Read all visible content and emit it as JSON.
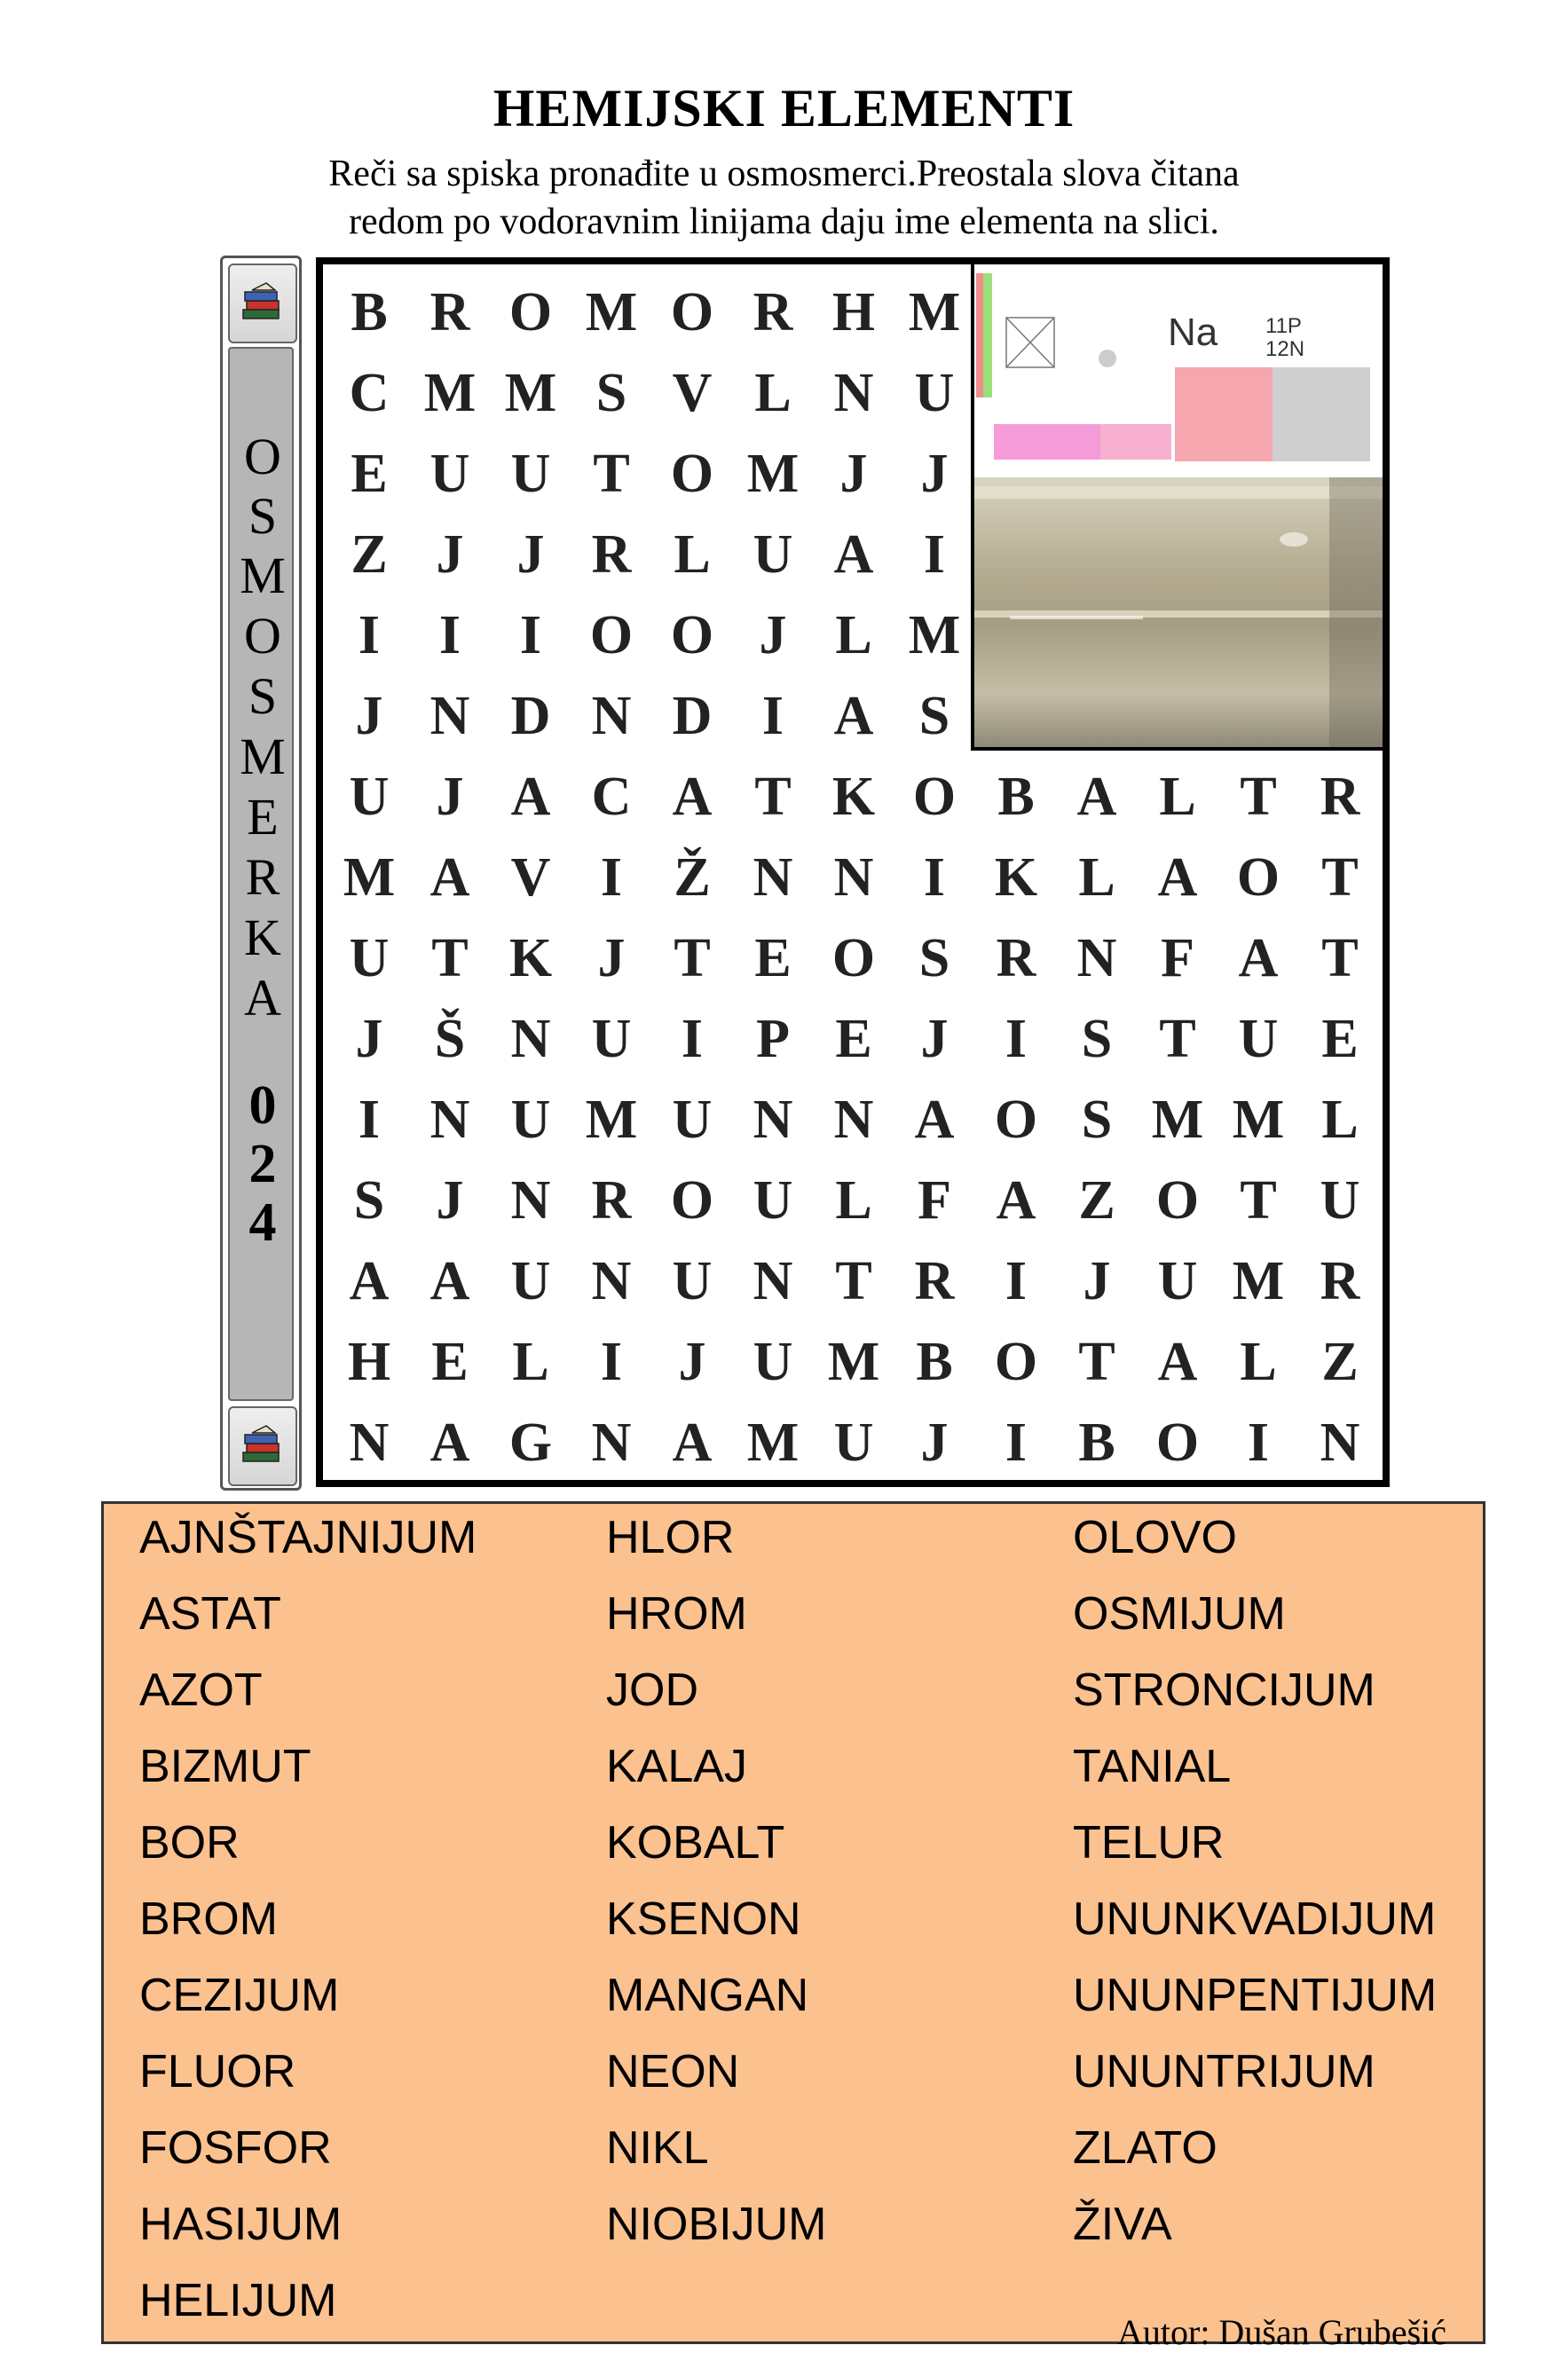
{
  "title": "HEMIJSKI ELEMENTI",
  "instructions": [
    "Reči sa spiska pronađite u osmosmerci.Preostala slova čitana",
    "redom po vodoravnim linijama daju ime elementa na slici."
  ],
  "sidebar": {
    "letters": [
      "O",
      "S",
      "M",
      "O",
      "S",
      "M",
      "E",
      "R",
      "K",
      "A"
    ],
    "number": [
      "0",
      "2",
      "4"
    ],
    "icon": "stacked-books-icon"
  },
  "grid": {
    "rows": [
      [
        "B",
        "R",
        "O",
        "M",
        "O",
        "R",
        "H",
        "M",
        "",
        "",
        "",
        "",
        ""
      ],
      [
        "C",
        "M",
        "M",
        "S",
        "V",
        "L",
        "N",
        "U",
        "",
        "",
        "",
        "",
        ""
      ],
      [
        "E",
        "U",
        "U",
        "T",
        "O",
        "M",
        "J",
        "J",
        "",
        "",
        "",
        "",
        ""
      ],
      [
        "Z",
        "J",
        "J",
        "R",
        "L",
        "U",
        "A",
        "I",
        "",
        "",
        "",
        "",
        ""
      ],
      [
        "I",
        "I",
        "I",
        "O",
        "O",
        "J",
        "L",
        "M",
        "",
        "",
        "",
        "",
        ""
      ],
      [
        "J",
        "N",
        "D",
        "N",
        "D",
        "I",
        "A",
        "S",
        "",
        "",
        "",
        "",
        ""
      ],
      [
        "U",
        "J",
        "A",
        "C",
        "A",
        "T",
        "K",
        "O",
        "B",
        "A",
        "L",
        "T",
        "R"
      ],
      [
        "M",
        "A",
        "V",
        "I",
        "Ž",
        "N",
        "N",
        "I",
        "K",
        "L",
        "A",
        "O",
        "T"
      ],
      [
        "U",
        "T",
        "K",
        "J",
        "T",
        "E",
        "O",
        "S",
        "R",
        "N",
        "F",
        "A",
        "T"
      ],
      [
        "J",
        "Š",
        "N",
        "U",
        "I",
        "P",
        "E",
        "J",
        "I",
        "S",
        "T",
        "U",
        "E"
      ],
      [
        "I",
        "N",
        "U",
        "M",
        "U",
        "N",
        "N",
        "A",
        "O",
        "S",
        "M",
        "M",
        "L"
      ],
      [
        "S",
        "J",
        "N",
        "R",
        "O",
        "U",
        "L",
        "F",
        "A",
        "Z",
        "O",
        "T",
        "U"
      ],
      [
        "A",
        "A",
        "U",
        "N",
        "U",
        "N",
        "T",
        "R",
        "I",
        "J",
        "U",
        "M",
        "R"
      ],
      [
        "H",
        "E",
        "L",
        "I",
        "J",
        "U",
        "M",
        "B",
        "O",
        "T",
        "A",
        "L",
        "Z"
      ],
      [
        "N",
        "A",
        "G",
        "N",
        "A",
        "M",
        "U",
        "J",
        "I",
        "B",
        "O",
        "I",
        "N"
      ]
    ]
  },
  "picture": {
    "symbol": "Na",
    "count_1": "11P",
    "count_2": "12N"
  },
  "word_columns": [
    [
      "AJNŠTAJNIJUM",
      "ASTAT",
      "AZOT",
      "BIZMUT",
      "BOR",
      "BROM",
      "CEZIJUM",
      "FLUOR",
      "FOSFOR",
      "HASIJUM",
      "HELIJUM"
    ],
    [
      "HLOR",
      "HROM",
      "JOD",
      "KALAJ",
      "KOBALT",
      "KSENON",
      "MANGAN",
      "NEON",
      "NIKL",
      "NIOBIJUM"
    ],
    [
      "OLOVO",
      "OSMIJUM",
      "STRONCIJUM",
      "TANIAL",
      "TELUR",
      "UNUNKVADIJUM",
      "UNUNPENTIJUM",
      "UNUNTRIJUM",
      "ZLATO",
      "ŽIVA"
    ]
  ],
  "author": "Autor: Dušan Grubešić",
  "colors": {
    "wordbox_bg": "#fbc18f",
    "sidebar_strip": "#b6b6b6",
    "grid_border": "#000000"
  }
}
